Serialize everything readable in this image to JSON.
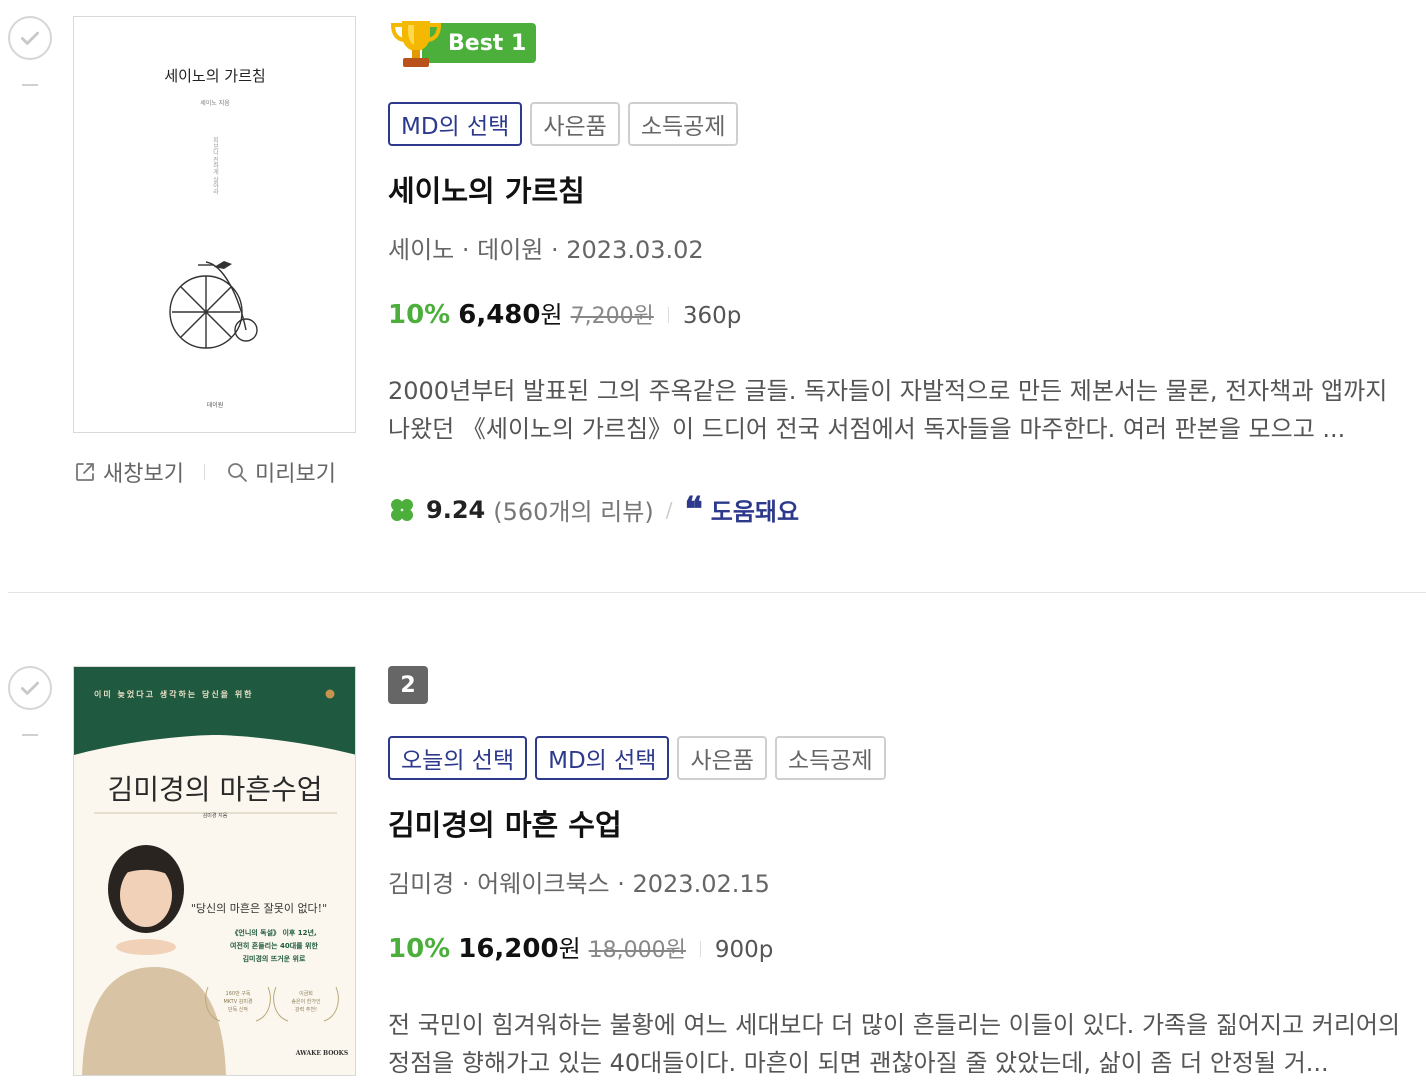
{
  "items": [
    {
      "best_label": "Best 1",
      "tags": [
        "MD의 선택",
        "사은품",
        "소득공제"
      ],
      "title": "세이노의 가르침",
      "meta": "세이노 · 데이원 · 2023.03.02",
      "discount": "10%",
      "price": "6,480",
      "won": "원",
      "original_price": "7,200원",
      "pages": "360p",
      "description": "2000년부터 발표된 그의 주옥같은 글들. 독자들이 자발적으로 만든 제본서는 물론, 전자책과 앱까지 나왔던 《세이노의 가르침》이 드디어 전국 서점에서 독자들을 마주한다. 여러 판본을 모으고 ...",
      "score": "9.24",
      "review_count": "(560개의 리뷰)",
      "helpful_label": "도움돼요",
      "cover": {
        "title": "세이노의 가르침",
        "author": "세이노 지음",
        "vertical_text": "피보다 진하게 살아라",
        "publisher": "데이원"
      }
    },
    {
      "rank": "2",
      "tags": [
        "오늘의 선택",
        "MD의 선택",
        "사은품",
        "소득공제"
      ],
      "title": "김미경의 마흔 수업",
      "meta": "김미경 · 어웨이크북스 · 2023.02.15",
      "discount": "10%",
      "price": "16,200",
      "won": "원",
      "original_price": "18,000원",
      "pages": "900p",
      "description": "전 국민이 힘겨워하는 불황에 여느 세대보다 더 많이 흔들리는 이들이 있다. 가족을 짊어지고 커리어의 정점을 향해가고 있는 40대들이다. 마흔이 되면 괜찮아질 줄 았았는데, 삶이 좀 더 안정될 거...",
      "cover": {
        "top_text": "이미 늦었다고 생각하는 당신을 위한",
        "title": "김미경의 마흔수업",
        "author": "김미경 지음",
        "quote": "\"당신의 마흔은 잘못이 없다!\"",
        "blurb1": "《언니의 독설》 이후 12년,",
        "blurb2": "여전히 흔들리는 40대를 위한",
        "blurb3": "김미경의 뜨거운 위로",
        "laurel1a": "160만 구독",
        "laurel1b": "MKTV 김미경",
        "laurel1c": "단독 신작",
        "laurel2a": "이금희",
        "laurel2b": "송은이 한가인",
        "laurel2c": "강력 추천!",
        "publisher": "AWAKE BOOKS"
      }
    }
  ],
  "cover_actions": {
    "new_window": "새창보기",
    "preview": "미리보기"
  },
  "colors": {
    "green": "#4caf3c",
    "navy": "#2d3a8c",
    "cover2_green": "#1f5a40"
  }
}
